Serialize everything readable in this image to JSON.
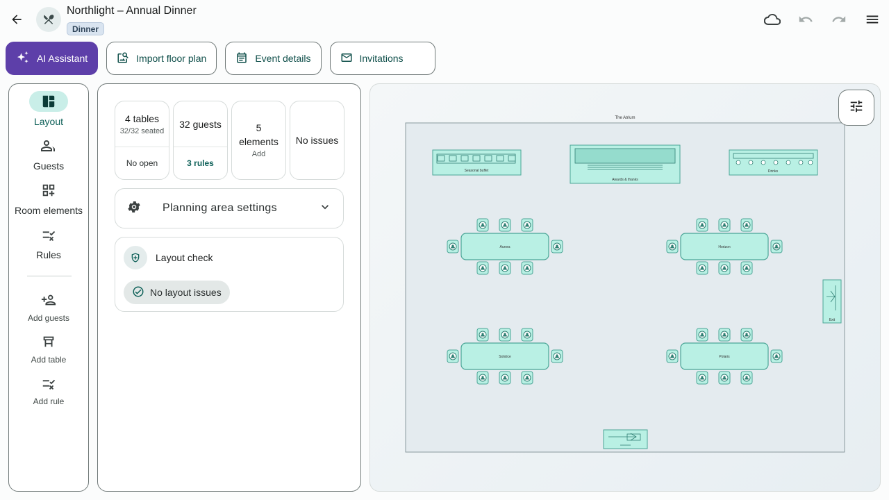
{
  "header": {
    "title": "Northlight – Annual Dinner",
    "badge": "Dinner"
  },
  "actions": {
    "ai": "AI Assistant",
    "import": "Import floor plan",
    "details": "Event details",
    "invitations": "Invitations"
  },
  "nav": {
    "items": [
      {
        "label": "Layout",
        "icon": "layout-icon",
        "active": true
      },
      {
        "label": "Guests",
        "icon": "guests-icon"
      },
      {
        "label": "Room elements",
        "icon": "room-elements-icon"
      },
      {
        "label": "Rules",
        "icon": "rules-icon"
      }
    ],
    "quick": [
      {
        "label": "Add guests",
        "icon": "add-guests-icon"
      },
      {
        "label": "Add table",
        "icon": "add-table-icon"
      },
      {
        "label": "Add rule",
        "icon": "add-rule-icon"
      }
    ]
  },
  "stats": {
    "tables": {
      "title": "4 tables",
      "sub": "32/32 seated",
      "action": "No open"
    },
    "guests": {
      "title": "32 guests",
      "action": "3 rules"
    },
    "elements": {
      "title": "5 elements",
      "action": "Add"
    },
    "issues": {
      "title": "No issues"
    }
  },
  "settings": {
    "label": "Planning area settings"
  },
  "layout_check": {
    "title": "Layout check",
    "status": "No layout issues"
  },
  "floor": {
    "room_label": "The Atrium",
    "elements": [
      "Seasonal buffet",
      "Awards & thanks",
      "Drinks",
      "Exit"
    ],
    "tables": [
      "Aurora",
      "Horizon",
      "Solstice",
      "Polaris"
    ]
  },
  "colors": {
    "accent": "#0f6159",
    "primary_button": "#5d3fa9",
    "table_fill": "#b9f0e4",
    "table_stroke": "#4aa596"
  }
}
